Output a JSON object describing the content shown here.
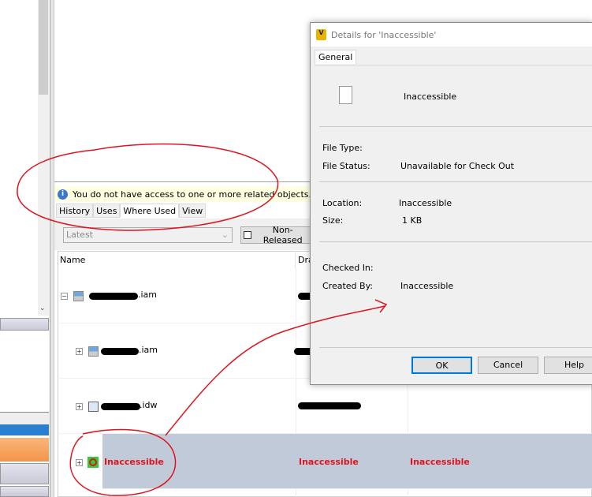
{
  "info_bar": {
    "message": "You do not have access to one or more related objects."
  },
  "tabs": [
    "History",
    "Uses",
    "Where Used",
    "View"
  ],
  "toolbar": {
    "version_combo": "Latest",
    "non_released_button": "Non-Released"
  },
  "grid": {
    "columns": [
      "Name",
      "Dra"
    ],
    "rows": [
      {
        "name_suffix": ".iam",
        "expander": "−"
      },
      {
        "name_suffix": ".iam",
        "expander": "+"
      },
      {
        "name_suffix": ".idw",
        "expander": "+"
      },
      {
        "name": "Inaccessible",
        "col2": "Inaccessible",
        "col3": "Inaccessible",
        "expander": "+",
        "selected": true
      }
    ]
  },
  "dialog": {
    "title": "Details for 'Inaccessible'",
    "tab": "General",
    "file_name": "Inaccessible",
    "file_type_label": "File Type:",
    "file_type": "",
    "file_status_label": "File Status:",
    "file_status": "Unavailable for Check Out",
    "location_label": "Location:",
    "location": "Inaccessible",
    "size_label": "Size:",
    "size": "1 KB",
    "checked_in_label": "Checked In:",
    "checked_in": "",
    "created_by_label": "Created By:",
    "created_by": "Inaccessible",
    "buttons": {
      "ok": "OK",
      "cancel": "Cancel",
      "help": "Help"
    }
  },
  "colors": {
    "annotation": "#e0141e",
    "selected_row": "#c0cad8",
    "info_bg": "#ffffe1",
    "accent_orange": "#f7a35c"
  }
}
